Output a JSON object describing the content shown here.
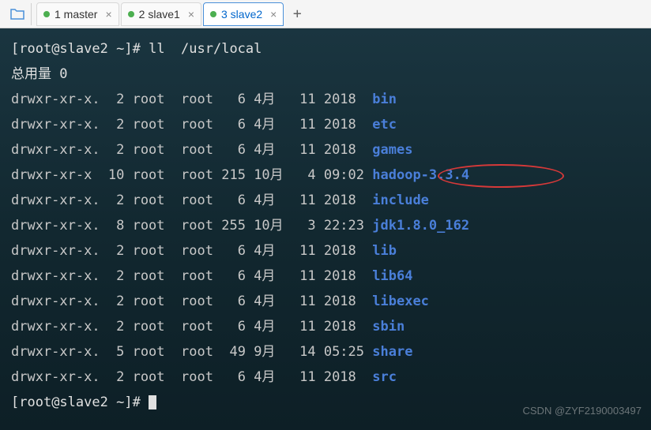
{
  "tabs": [
    {
      "label": "1 master"
    },
    {
      "label": "2 slave1"
    },
    {
      "label": "3 slave2"
    }
  ],
  "prompt": {
    "user_host": "root@slave2",
    "path": "~",
    "symbol": "#",
    "command": "ll  /usr/local"
  },
  "total_line": "总用量 0",
  "listing": [
    {
      "perms": "drwxr-xr-x.",
      "links": " 2",
      "owner": "root",
      "group": "root",
      "size": "  6",
      "month": "4月 ",
      "day": "11",
      "time": "2018 ",
      "name": "bin"
    },
    {
      "perms": "drwxr-xr-x.",
      "links": " 2",
      "owner": "root",
      "group": "root",
      "size": "  6",
      "month": "4月 ",
      "day": "11",
      "time": "2018 ",
      "name": "etc"
    },
    {
      "perms": "drwxr-xr-x.",
      "links": " 2",
      "owner": "root",
      "group": "root",
      "size": "  6",
      "month": "4月 ",
      "day": "11",
      "time": "2018 ",
      "name": "games"
    },
    {
      "perms": "drwxr-xr-x ",
      "links": "10",
      "owner": "root",
      "group": "root",
      "size": "215",
      "month": "10月",
      "day": " 4",
      "time": "09:02",
      "name": "hadoop-3.3.4"
    },
    {
      "perms": "drwxr-xr-x.",
      "links": " 2",
      "owner": "root",
      "group": "root",
      "size": "  6",
      "month": "4月 ",
      "day": "11",
      "time": "2018 ",
      "name": "include"
    },
    {
      "perms": "drwxr-xr-x.",
      "links": " 8",
      "owner": "root",
      "group": "root",
      "size": "255",
      "month": "10月",
      "day": " 3",
      "time": "22:23",
      "name": "jdk1.8.0_162"
    },
    {
      "perms": "drwxr-xr-x.",
      "links": " 2",
      "owner": "root",
      "group": "root",
      "size": "  6",
      "month": "4月 ",
      "day": "11",
      "time": "2018 ",
      "name": "lib"
    },
    {
      "perms": "drwxr-xr-x.",
      "links": " 2",
      "owner": "root",
      "group": "root",
      "size": "  6",
      "month": "4月 ",
      "day": "11",
      "time": "2018 ",
      "name": "lib64"
    },
    {
      "perms": "drwxr-xr-x.",
      "links": " 2",
      "owner": "root",
      "group": "root",
      "size": "  6",
      "month": "4月 ",
      "day": "11",
      "time": "2018 ",
      "name": "libexec"
    },
    {
      "perms": "drwxr-xr-x.",
      "links": " 2",
      "owner": "root",
      "group": "root",
      "size": "  6",
      "month": "4月 ",
      "day": "11",
      "time": "2018 ",
      "name": "sbin"
    },
    {
      "perms": "drwxr-xr-x.",
      "links": " 5",
      "owner": "root",
      "group": "root",
      "size": " 49",
      "month": "9月 ",
      "day": "14",
      "time": "05:25",
      "name": "share"
    },
    {
      "perms": "drwxr-xr-x.",
      "links": " 2",
      "owner": "root",
      "group": "root",
      "size": "  6",
      "month": "4月 ",
      "day": "11",
      "time": "2018 ",
      "name": "src"
    }
  ],
  "watermark": "CSDN @ZYF2190003497"
}
